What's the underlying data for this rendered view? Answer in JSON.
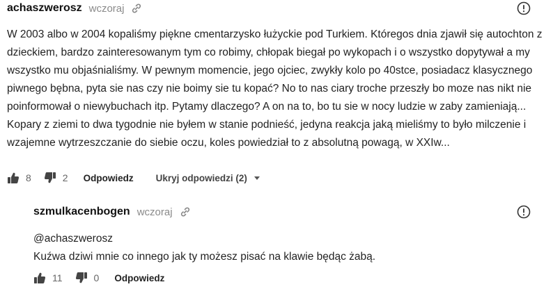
{
  "comments": [
    {
      "author": "achaszwerosz",
      "time": "wczoraj",
      "text": "W 2003 albo w 2004 kopaliśmy piękne cmentarzysko łużyckie pod Turkiem. Któregos dnia zjawił się autochton z dzieckiem, bardzo zainteresowanym tym co robimy, chłopak biegał po wykopach i o wszystko dopytywał a my wszystko mu objaśnialiśmy. W pewnym momencie, jego ojciec, zwykły kolo po 40stce, posiadacz klasycznego piwnego bębna, pyta sie nas czy nie boimy sie tu kopać? No to nas ciary troche przeszły bo moze nas nikt nie poinformował o niewybuchach itp. Pytamy dlaczego? A on na to, bo tu sie w nocy ludzie w zaby zamieniają... Kopary z ziemi to dwa tygodnie nie byłem w stanie podnieść, jedyna reakcja jaką mieliśmy to było milczenie i wzajemne wytrzeszczanie do siebie oczu, koles powiedział to z absolutną powagą, w XXIw...",
      "likes": "8",
      "dislikes": "2",
      "reply_label": "Odpowiedz",
      "toggle_label": "Ukryj odpowiedzi (2)"
    },
    {
      "author": "szmulkacenbogen",
      "time": "wczoraj",
      "mention": "@achaszwerosz",
      "text": "Kuźwa dziwi mnie co innego jak ty możesz pisać na klawie będąc żabą.",
      "likes": "11",
      "dislikes": "0",
      "reply_label": "Odpowiedz"
    }
  ],
  "icons": {
    "link": "link-icon",
    "report": "report-icon",
    "like": "thumbs-up-icon",
    "dislike": "thumbs-down-icon",
    "caret": "chevron-down-icon"
  },
  "colors": {
    "text": "#222222",
    "muted": "#8a8a8a",
    "icon": "#555555"
  }
}
